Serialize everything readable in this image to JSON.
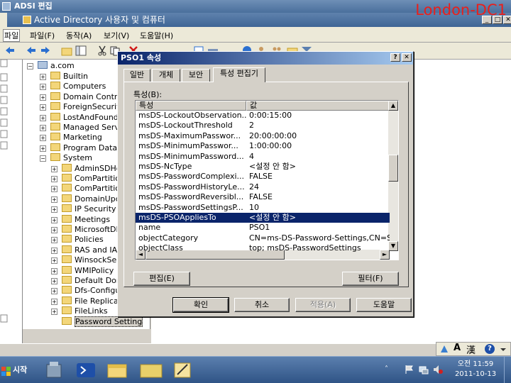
{
  "outer_window": {
    "title": "ADSI 편집",
    "menu_first": "파일"
  },
  "aduc_window": {
    "title": "Active Directory 사용자 및 컴퓨터",
    "watermark": "London-DC1"
  },
  "menu": [
    "파일(F)",
    "동작(A)",
    "보기(V)",
    "도움말(H)"
  ],
  "tree": {
    "root": "a.com",
    "items": [
      {
        "label": "Builtin",
        "level": 1
      },
      {
        "label": "Computers",
        "level": 1
      },
      {
        "label": "Domain Contro",
        "level": 1
      },
      {
        "label": "ForeignSecurit",
        "level": 1
      },
      {
        "label": "LostAndFound",
        "level": 1
      },
      {
        "label": "Managed Serv",
        "level": 1
      },
      {
        "label": "Marketing",
        "level": 1
      },
      {
        "label": "Program Data",
        "level": 1
      },
      {
        "label": "System",
        "level": 1
      },
      {
        "label": "AdminSDHo",
        "level": 2
      },
      {
        "label": "ComPartitic",
        "level": 2
      },
      {
        "label": "ComPartitic",
        "level": 2
      },
      {
        "label": "DomainUpc",
        "level": 2
      },
      {
        "label": "IP Security",
        "level": 2
      },
      {
        "label": "Meetings",
        "level": 2
      },
      {
        "label": "MicrosoftDN",
        "level": 2
      },
      {
        "label": "Policies",
        "level": 2
      },
      {
        "label": "RAS and IA",
        "level": 2
      },
      {
        "label": "WinsockSe",
        "level": 2
      },
      {
        "label": "WMIPolicy",
        "level": 2
      },
      {
        "label": "Default Don",
        "level": 2
      },
      {
        "label": "Dfs-Configu",
        "level": 2
      },
      {
        "label": "File Replica",
        "level": 2
      },
      {
        "label": "FileLinks",
        "level": 2
      },
      {
        "label": "Password Setting",
        "level": 2
      }
    ]
  },
  "dialog": {
    "title": "PSO1 속성",
    "help_btn": "?",
    "close_btn": "✕",
    "tabs": [
      "일반",
      "개체",
      "보안",
      "특성 편집기"
    ],
    "attributes_label": "특성(B):",
    "columns": [
      "특성",
      "값"
    ],
    "rows": [
      {
        "attr": "msDS-LockoutObservation...",
        "value": "0:00:15:00"
      },
      {
        "attr": "msDS-LockoutThreshold",
        "value": "2"
      },
      {
        "attr": "msDS-MaximumPasswor...",
        "value": "20:00:00:00"
      },
      {
        "attr": "msDS-MinimumPasswor...",
        "value": "1:00:00:00"
      },
      {
        "attr": "msDS-MinimumPassword...",
        "value": "4"
      },
      {
        "attr": "msDS-NcType",
        "value": "<설정 안 함>"
      },
      {
        "attr": "msDS-PasswordComplexi...",
        "value": "FALSE"
      },
      {
        "attr": "msDS-PasswordHistoryLe...",
        "value": "24"
      },
      {
        "attr": "msDS-PasswordReversibl...",
        "value": "FALSE"
      },
      {
        "attr": "msDS-PasswordSettingsP...",
        "value": "10"
      },
      {
        "attr": "msDS-PSOAppliesTo",
        "value": "<설정 안 함>"
      },
      {
        "attr": "name",
        "value": "PSO1"
      },
      {
        "attr": "objectCategory",
        "value": "CN=ms-DS-Password-Settings,CN=Sc"
      },
      {
        "attr": "objectClass",
        "value": "top; msDS-PasswordSettings"
      }
    ],
    "selected_index": 10,
    "edit_btn": "편집(E)",
    "filter_btn": "필터(F)",
    "ok_btn": "확인",
    "cancel_btn": "취소",
    "apply_btn": "적용(A)",
    "help_btn_bottom": "도움말"
  },
  "taskbar": {
    "start": "시작",
    "clock_time": "오전 11:59",
    "clock_date": "2011-10-13"
  },
  "langbar": {
    "mode": "A",
    "hanja": "漢",
    "help": "?"
  },
  "colors": {
    "selection": "#0a246a",
    "watermark": "#e8201c",
    "taskbar": "#2f5486"
  }
}
